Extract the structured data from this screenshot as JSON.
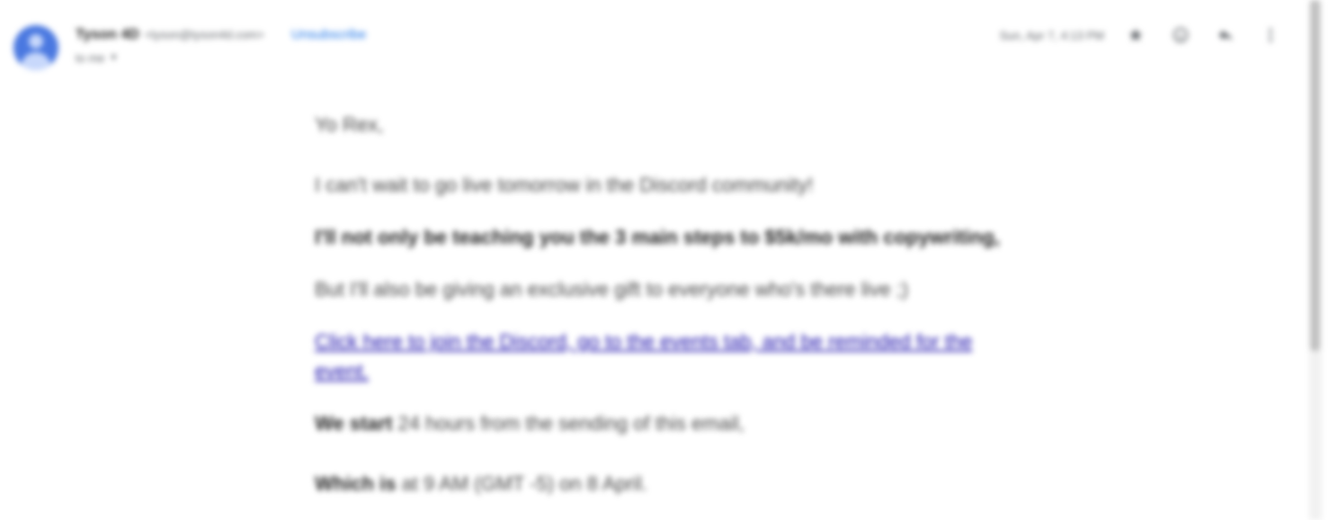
{
  "header": {
    "sender_name": "Tyson 4D",
    "sender_email": "<tyson@tyson4d.com>",
    "unsubscribe_label": "Unsubscribe",
    "to_label": "to me",
    "date": "Sun, Apr 7, 4:13 PM",
    "icons": [
      "star-icon",
      "emoji-icon",
      "reply-icon",
      "more-vert-icon"
    ]
  },
  "body": {
    "greeting": "Yo Rex,",
    "p1": "I can't wait to go live tomorrow in the Discord community!",
    "p2": "I'll not only be teaching you the 3 main steps to $5k/mo with copywriting,",
    "p3": "But I'll also be giving an exclusive gift to everyone who's there live ;)",
    "link": "Click here to join the Discord, go to the events tab, and be reminded for the event.",
    "p4_bold": "We start",
    "p4_rest": " 24 hours from the sending of this email,",
    "p5_bold": "Which is",
    "p5_rest": " at 9 AM (GMT -5) on 8 April."
  },
  "colors": {
    "link": "#1a0dab",
    "unsubscribe": "#1a73e8",
    "avatar": "#4a78e0"
  }
}
